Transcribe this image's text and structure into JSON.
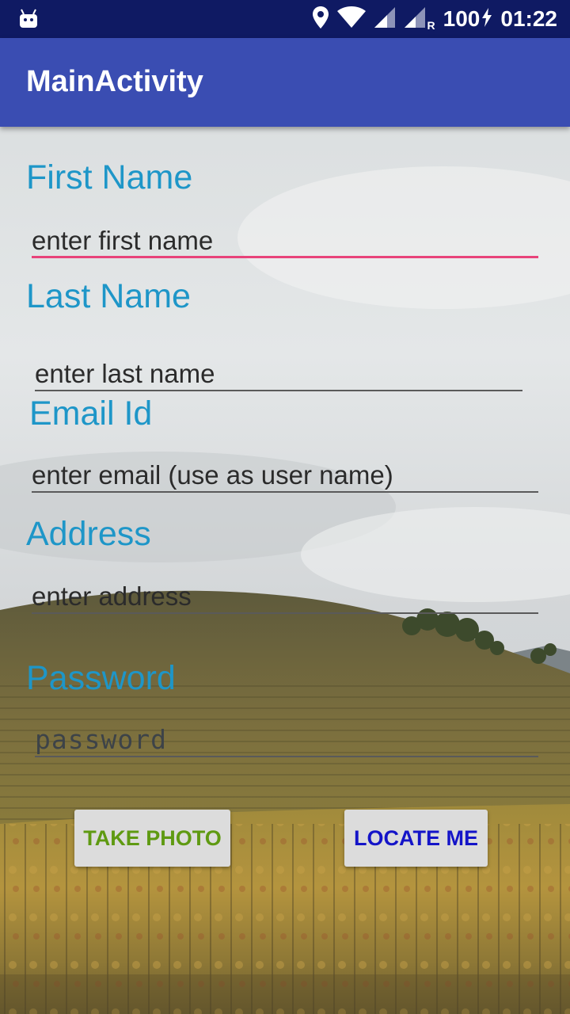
{
  "status_bar": {
    "battery": "100",
    "time": "01:22",
    "roaming_indicator": "R",
    "icons": [
      "android-icon",
      "location-icon",
      "wifi-icon",
      "signal-icon",
      "signal-roaming-icon",
      "charging-icon"
    ]
  },
  "app_bar": {
    "title": "MainActivity"
  },
  "form": {
    "first_name": {
      "label": "First Name",
      "placeholder": "enter first name"
    },
    "last_name": {
      "label": "Last Name",
      "placeholder": "enter last name"
    },
    "email": {
      "label": "Email Id",
      "placeholder": "enter email (use as user name)"
    },
    "address": {
      "label": "Address",
      "placeholder": "enter address"
    },
    "password": {
      "label": "Password",
      "placeholder": "password"
    }
  },
  "buttons": {
    "take_photo": {
      "label": "TAKE PHOTO",
      "color": "#5f9a12"
    },
    "locate_me": {
      "label": "LOCATE ME",
      "color": "#1414c8"
    }
  },
  "colors": {
    "status_bar": "#0f1a63",
    "app_bar": "#3a4db2",
    "label": "#1e96c8",
    "focus_underline": "#e8437a"
  }
}
